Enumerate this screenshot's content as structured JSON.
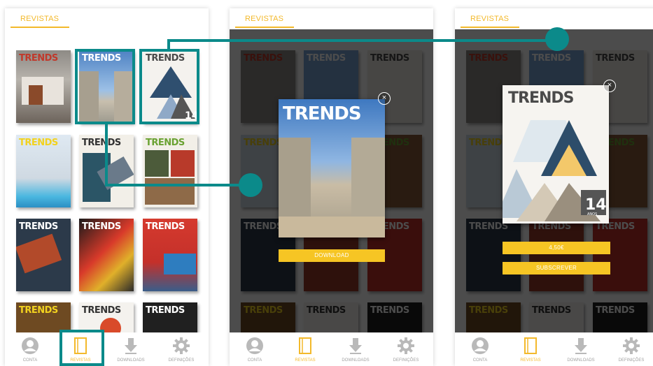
{
  "header": {
    "title": "REVISTAS"
  },
  "magazine": {
    "logo": "TRENDS"
  },
  "tabs": [
    {
      "label": "CONTA",
      "icon": "user-icon"
    },
    {
      "label": "REVISTAS",
      "icon": "magazine-icon"
    },
    {
      "label": "DOWNLOADS",
      "icon": "download-icon"
    },
    {
      "label": "DEFINIÇÕES",
      "icon": "gear-icon"
    }
  ],
  "modal_download": {
    "close": "×",
    "button": "DOWNLOAD"
  },
  "modal_purchase": {
    "close": "×",
    "price": "4,50€",
    "subscribe": "SUBSCREVER",
    "issue_number": "14",
    "issue_label": "ANOS"
  },
  "colors": {
    "accent": "#f3b92b",
    "highlight": "#0b8a8a",
    "button": "#f6c524"
  }
}
